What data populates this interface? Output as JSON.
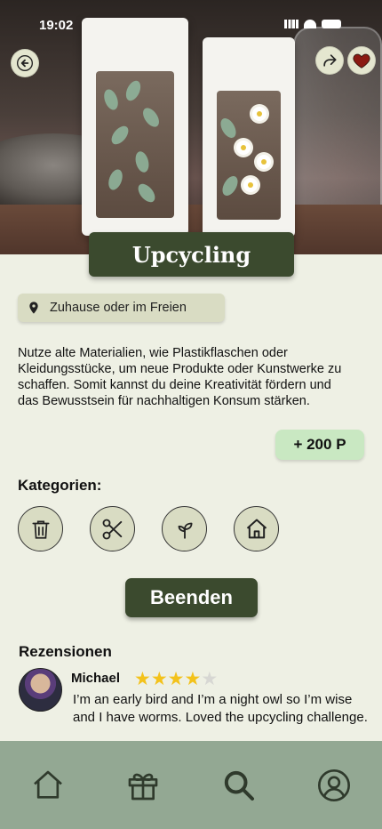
{
  "status_bar": {
    "time": "19:02"
  },
  "hero": {
    "title": "Upcycling"
  },
  "location": {
    "label": "Zuhause oder im Freien"
  },
  "description": "Nutze alte Materialien, wie Plastikflaschen oder Kleidungsstücke, um neue Produkte oder Kunstwerke zu schaffen. Somit kannst du deine Kreativität fördern und das Bewusstsein für nachhaltigen Konsum stärken.",
  "points": "+ 200 P",
  "categories": {
    "label": "Kategorien:",
    "icons": [
      "trash-icon",
      "scissors-icon",
      "sprout-icon",
      "home-icon"
    ]
  },
  "finish_button": "Beenden",
  "reviews": {
    "label": "Rezensionen",
    "items": [
      {
        "name": "Michael",
        "rating": 4,
        "max_rating": 5,
        "text": "I’m an early bird and I’m a night owl so I’m wise and I have worms. Loved the upcycling challenge."
      }
    ]
  },
  "tabbar": {
    "items": [
      "home-icon",
      "gift-icon",
      "search-icon",
      "profile-icon"
    ]
  },
  "colors": {
    "accent": "#3b4a2e",
    "background": "#eef0e4",
    "tabbar": "#93a893",
    "points_bg": "#c9e8c2",
    "chip_bg": "#d9dcc3",
    "favorite": "#8b1a12"
  }
}
